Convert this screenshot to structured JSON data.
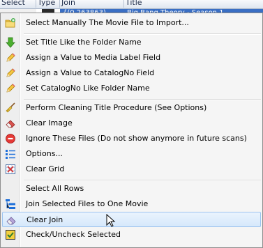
{
  "grid": {
    "columns": [
      "Select",
      "Type",
      "Join",
      "Title"
    ],
    "row": {
      "join": "{(0 263863)",
      "title": "Big Bang Theory - Season 1"
    }
  },
  "menu": {
    "items": [
      {
        "label": "Select Manually The Movie File to Import...",
        "icon": "folder-add-icon"
      },
      {
        "label": "Set Title Like the Folder Name",
        "icon": "green-arrow-down-icon"
      },
      {
        "label": "Assign a Value to Media Label Field",
        "icon": "pencil-icon"
      },
      {
        "label": "Assign a Value to CatalogNo Field",
        "icon": "pencil-icon"
      },
      {
        "label": "Set CatalogNo Like Folder Name",
        "icon": "pencil-icon"
      },
      {
        "label": "Perform Cleaning Title Procedure (See Options)",
        "icon": "broom-icon"
      },
      {
        "label": "Clear Image",
        "icon": "eraser-red-icon"
      },
      {
        "label": "Ignore These Files (Do not show anymore in future scans)",
        "icon": "no-entry-icon"
      },
      {
        "label": "Options...",
        "icon": "options-list-icon"
      },
      {
        "label": "Clear Grid",
        "icon": "clear-grid-icon"
      },
      {
        "label": "Select All Rows",
        "icon": ""
      },
      {
        "label": "Join Selected Files to One Movie",
        "icon": "tree-join-icon"
      },
      {
        "label": "Clear Join",
        "icon": "eraser-icon"
      },
      {
        "label": "Check/Uncheck Selected",
        "icon": "checkbox-icon"
      }
    ]
  }
}
